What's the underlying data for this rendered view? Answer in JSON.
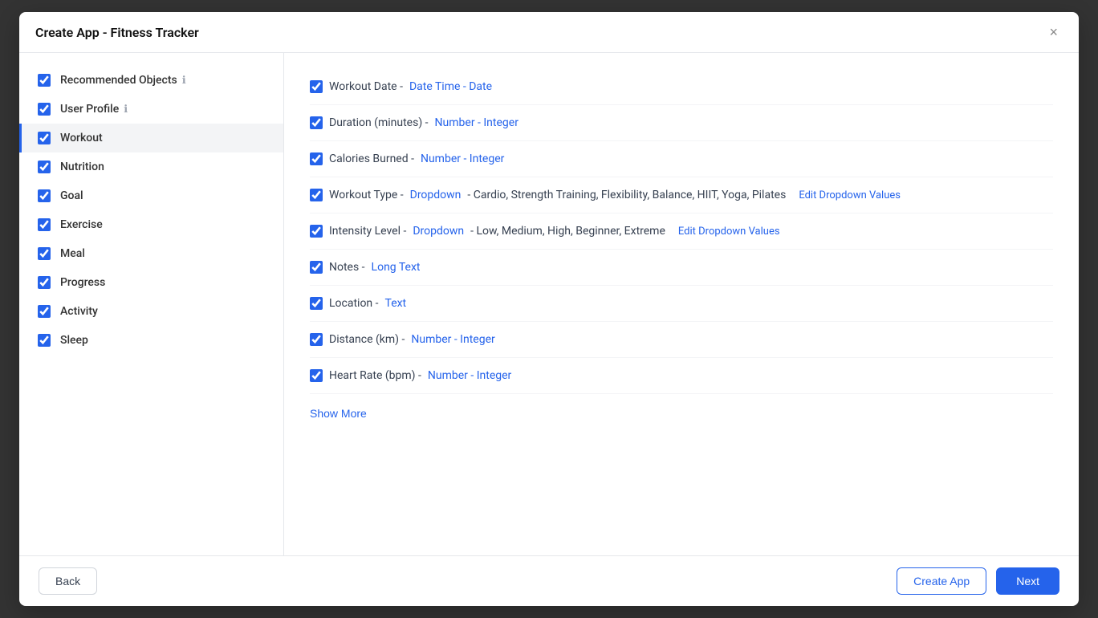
{
  "modal": {
    "title": "Create App - Fitness Tracker",
    "close_label": "×"
  },
  "sidebar": {
    "items": [
      {
        "id": "recommended-objects",
        "label": "Recommended Objects",
        "checked": true,
        "info": true,
        "active": false
      },
      {
        "id": "user-profile",
        "label": "User Profile",
        "checked": true,
        "info": true,
        "active": false
      },
      {
        "id": "workout",
        "label": "Workout",
        "checked": true,
        "info": false,
        "active": true
      },
      {
        "id": "nutrition",
        "label": "Nutrition",
        "checked": true,
        "info": false,
        "active": false
      },
      {
        "id": "goal",
        "label": "Goal",
        "checked": true,
        "info": false,
        "active": false
      },
      {
        "id": "exercise",
        "label": "Exercise",
        "checked": true,
        "info": false,
        "active": false
      },
      {
        "id": "meal",
        "label": "Meal",
        "checked": true,
        "info": false,
        "active": false
      },
      {
        "id": "progress",
        "label": "Progress",
        "checked": true,
        "info": false,
        "active": false
      },
      {
        "id": "activity",
        "label": "Activity",
        "checked": true,
        "info": false,
        "active": false
      },
      {
        "id": "sleep",
        "label": "Sleep",
        "checked": true,
        "info": false,
        "active": false
      }
    ]
  },
  "fields": [
    {
      "id": "workout-date",
      "label": "Workout Date",
      "separator": " - ",
      "type_label": "Date Time - Date",
      "extra": "",
      "edit_dropdown": false,
      "edit_dropdown_label": ""
    },
    {
      "id": "duration-minutes",
      "label": "Duration (minutes)",
      "separator": " - ",
      "type_label": "Number - Integer",
      "extra": "",
      "edit_dropdown": false,
      "edit_dropdown_label": ""
    },
    {
      "id": "calories-burned",
      "label": "Calories Burned",
      "separator": " - ",
      "type_label": "Number - Integer",
      "extra": "",
      "edit_dropdown": false,
      "edit_dropdown_label": ""
    },
    {
      "id": "workout-type",
      "label": "Workout Type",
      "separator": " - ",
      "type_label": "Dropdown",
      "extra": " - Cardio, Strength Training, Flexibility, Balance, HIIT, Yoga, Pilates",
      "edit_dropdown": true,
      "edit_dropdown_label": "Edit Dropdown Values"
    },
    {
      "id": "intensity-level",
      "label": "Intensity Level",
      "separator": " - ",
      "type_label": "Dropdown",
      "extra": " - Low, Medium, High, Beginner, Extreme",
      "edit_dropdown": true,
      "edit_dropdown_label": "Edit Dropdown Values"
    },
    {
      "id": "notes",
      "label": "Notes",
      "separator": " - ",
      "type_label": "Long Text",
      "extra": "",
      "edit_dropdown": false,
      "edit_dropdown_label": ""
    },
    {
      "id": "location",
      "label": "Location",
      "separator": " - ",
      "type_label": "Text",
      "extra": "",
      "edit_dropdown": false,
      "edit_dropdown_label": ""
    },
    {
      "id": "distance-km",
      "label": "Distance (km)",
      "separator": " - ",
      "type_label": "Number - Integer",
      "extra": "",
      "edit_dropdown": false,
      "edit_dropdown_label": ""
    },
    {
      "id": "heart-rate-bpm",
      "label": "Heart Rate (bpm)",
      "separator": " - ",
      "type_label": "Number - Integer",
      "extra": "",
      "edit_dropdown": false,
      "edit_dropdown_label": ""
    }
  ],
  "show_more_label": "Show More",
  "footer": {
    "back_label": "Back",
    "create_app_label": "Create App",
    "next_label": "Next"
  }
}
